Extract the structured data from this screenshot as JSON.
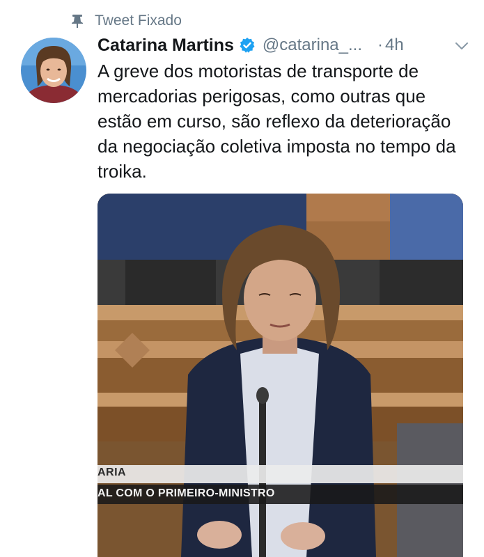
{
  "pinned": {
    "label": "Tweet Fixado",
    "icon": "pin-icon"
  },
  "author": {
    "name": "Catarina Martins",
    "verified": true,
    "verified_icon": "verified-badge-icon",
    "handle": "@catarina_...",
    "time_separator": "·",
    "time": "4h",
    "avatar_icon": "profile-avatar"
  },
  "menu": {
    "icon": "chevron-down-icon"
  },
  "tweet": {
    "text": "A greve dos motoristas de transporte de mercadorias perigosas, como outras que estão em curso, são reflexo da deterioração da negociação coletiva imposta no tempo da troika."
  },
  "media": {
    "type": "video-still",
    "lower_third_title": "ARIA",
    "lower_third_caption": "AL COM O PRIMEIRO-MINISTRO"
  },
  "colors": {
    "text_primary": "#14171a",
    "text_secondary": "#657786",
    "verified_blue": "#1da1f2"
  }
}
